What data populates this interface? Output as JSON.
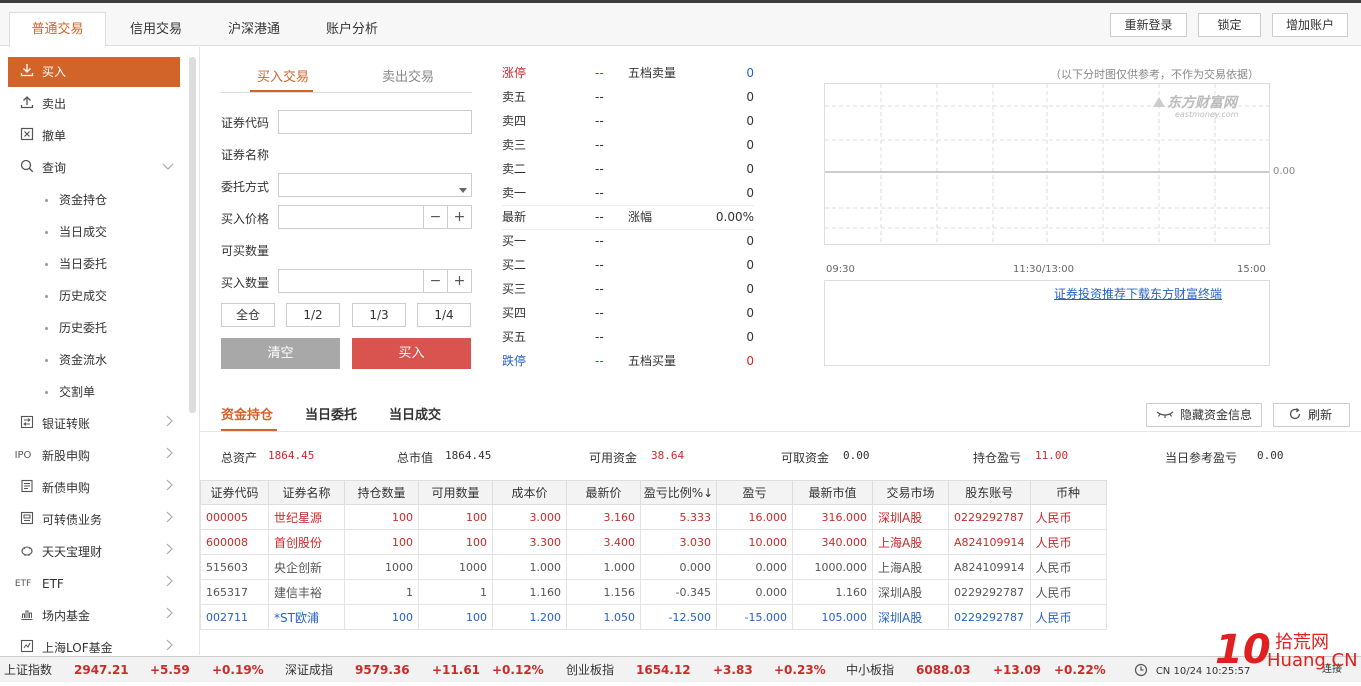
{
  "topnav": {
    "tabs": [
      "普通交易",
      "信用交易",
      "沪深港通",
      "账户分析"
    ],
    "buttons": [
      "重新登录",
      "锁定",
      "增加账户"
    ]
  },
  "sidebar": {
    "buy": "买入",
    "sell": "卖出",
    "cancel": "撤单",
    "query": "查询",
    "query_subs": [
      "资金持仓",
      "当日成交",
      "当日委托",
      "历史成交",
      "历史委托",
      "资金流水",
      "交割单"
    ],
    "more": [
      "银证转账",
      "新股申购",
      "新债申购",
      "可转债业务",
      "天天宝理财",
      "ETF",
      "场内基金",
      "上海LOF基金"
    ],
    "more_icons": [
      "bank-transfer-icon",
      "ipo-icon",
      "bond-icon",
      "convertible-bond-icon",
      "piggy-bank-icon",
      "etf-icon",
      "fund-icon",
      "lof-fund-icon"
    ],
    "ipo_icon_text": "IPO",
    "etf_icon_text": "ETF"
  },
  "order_form": {
    "tab_buy": "买入交易",
    "tab_sell": "卖出交易",
    "code_label": "证券代码",
    "name_label": "证券名称",
    "method_label": "委托方式",
    "price_label": "买入价格",
    "avail_label": "可买数量",
    "qty_label": "买入数量",
    "minus": "−",
    "plus": "+",
    "fractions": [
      "全仓",
      "1/2",
      "1/3",
      "1/4"
    ],
    "clear_btn": "清空",
    "buy_btn": "买入"
  },
  "quote": {
    "rows": [
      {
        "label": "涨停",
        "price": "--",
        "qty": "",
        "cls": "red"
      },
      {
        "label": "卖五",
        "price": "--",
        "qty": "0",
        "cls": ""
      },
      {
        "label": "卖四",
        "price": "--",
        "qty": "0",
        "cls": ""
      },
      {
        "label": "卖三",
        "price": "--",
        "qty": "0",
        "cls": ""
      },
      {
        "label": "卖二",
        "price": "--",
        "qty": "0",
        "cls": ""
      },
      {
        "label": "卖一",
        "price": "--",
        "qty": "0",
        "cls": ""
      },
      {
        "label": "最新",
        "price": "--",
        "qty": "0.00%",
        "cls": ""
      },
      {
        "label": "买一",
        "price": "--",
        "qty": "0",
        "cls": ""
      },
      {
        "label": "买二",
        "price": "--",
        "qty": "0",
        "cls": ""
      },
      {
        "label": "买三",
        "price": "--",
        "qty": "0",
        "cls": ""
      },
      {
        "label": "买四",
        "price": "--",
        "qty": "0",
        "cls": ""
      },
      {
        "label": "买五",
        "price": "--",
        "qty": "0",
        "cls": ""
      },
      {
        "label": "跌停",
        "price": "--",
        "qty": "0",
        "cls": "blue"
      }
    ],
    "sell5_label": "五档卖量",
    "sell5_value": "0",
    "buy5_label": "五档买量",
    "buy5_value": "0",
    "change_label": "涨幅"
  },
  "chart": {
    "note": "（以下分时图仅供参考，不作为交易依据）",
    "logo_text": "东方财富网",
    "logo_sub": "eastmoney.com",
    "y_label": "0.00",
    "x_labels": [
      "09:30",
      "11:30/13:00",
      "15:00"
    ],
    "link": "证券投资推荐下载东方财富终端"
  },
  "bottom_tabs": [
    "资金持仓",
    "当日委托",
    "当日成交"
  ],
  "actions": {
    "hide": "隐藏资金信息",
    "refresh": "刷新"
  },
  "summary": [
    {
      "label": "总资产",
      "value": "1864.45"
    },
    {
      "label": "总市值",
      "value": "1864.45"
    },
    {
      "label": "可用资金",
      "value": "38.64"
    },
    {
      "label": "可取资金",
      "value": "0.00"
    },
    {
      "label": "持仓盈亏",
      "value": "11.00"
    },
    {
      "label": "当日参考盈亏",
      "value": "0.00"
    }
  ],
  "table": {
    "headers": [
      "证券代码",
      "证券名称",
      "持仓数量",
      "可用数量",
      "成本价",
      "最新价",
      "盈亏比例%↓",
      "盈亏",
      "最新市值",
      "交易市场",
      "股东账号",
      "币种"
    ],
    "rows": [
      {
        "cls": "red",
        "cells": [
          "000005",
          "世纪星源",
          "100",
          "100",
          "3.000",
          "3.160",
          "5.333",
          "16.000",
          "316.000",
          "深圳A股",
          "0229292787",
          "人民币"
        ]
      },
      {
        "cls": "red",
        "cells": [
          "600008",
          "首创股份",
          "100",
          "100",
          "3.300",
          "3.400",
          "3.030",
          "10.000",
          "340.000",
          "上海A股",
          "A824109914",
          "人民币"
        ]
      },
      {
        "cls": "gray",
        "cells": [
          "515603",
          "央企创新",
          "1000",
          "1000",
          "1.000",
          "1.000",
          "0.000",
          "0.000",
          "1000.000",
          "上海A股",
          "A824109914",
          "人民币"
        ]
      },
      {
        "cls": "gray",
        "cells": [
          "165317",
          "建信丰裕",
          "1",
          "1",
          "1.160",
          "1.156",
          "-0.345",
          "0.000",
          "1.160",
          "深圳A股",
          "0229292787",
          "人民币"
        ]
      },
      {
        "cls": "blue",
        "cells": [
          "002711",
          "*ST欧浦",
          "100",
          "100",
          "1.200",
          "1.050",
          "-12.500",
          "-15.000",
          "105.000",
          "深圳A股",
          "0229292787",
          "人民币"
        ]
      }
    ]
  },
  "ticker": [
    {
      "name": "上证指数",
      "value": "2947.21",
      "change": "+5.59",
      "pct": "+0.19%"
    },
    {
      "name": "深证成指",
      "value": "9579.36",
      "change": "+11.61",
      "pct": "+0.12%"
    },
    {
      "name": "创业板指",
      "value": "1654.12",
      "change": "+3.83",
      "pct": "+0.23%"
    },
    {
      "name": "中小板指",
      "value": "6088.03",
      "change": "+13.09",
      "pct": "+0.22%"
    }
  ],
  "status": {
    "clock_text": "CN 10/24 10:25:57",
    "conn": "连接"
  },
  "watermark": {
    "main": "10",
    "site": "拾荒网",
    "domain": "Huang.CN"
  },
  "colors": {
    "accent": "#d2642a",
    "red": "#cc2929",
    "blue": "#2762c8",
    "btn_red": "#d9534f",
    "btn_gray": "#a8a8a8"
  }
}
